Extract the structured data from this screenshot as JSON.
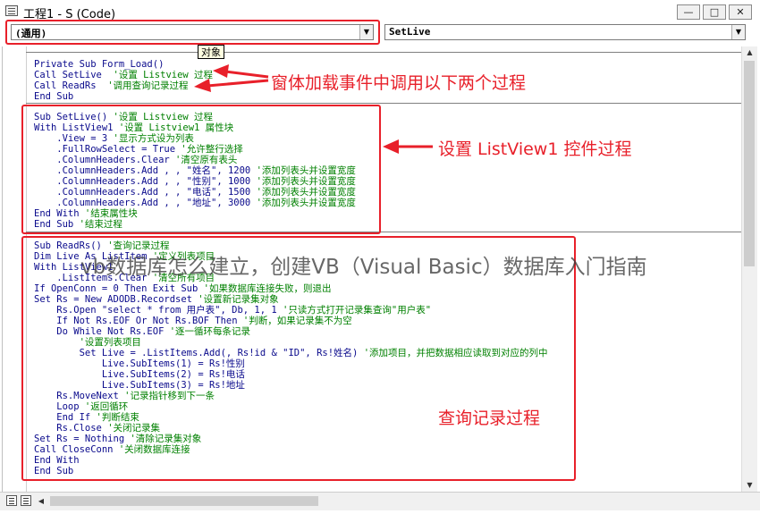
{
  "window": {
    "title": "工程1 - S (Code)"
  },
  "object_combo": {
    "value": "(通用)"
  },
  "proc_combo": {
    "value": "SetLive"
  },
  "tooltip": "对象",
  "code": {
    "form_load": [
      [
        [
          "kw",
          "Private Sub Form_Load()"
        ]
      ],
      [
        [
          "kw",
          "Call SetLive  "
        ],
        [
          "cm",
          "'设置 Listview 过程"
        ]
      ],
      [
        [
          "kw",
          "Call ReadRs  "
        ],
        [
          "cm",
          "'调用查询记录过程"
        ]
      ],
      [
        [
          "kw",
          "End Sub"
        ]
      ]
    ],
    "setlive": [
      [
        [
          "kw",
          "Sub SetLive() "
        ],
        [
          "cm",
          "'设置 Listview 过程"
        ]
      ],
      [
        [
          "kw",
          "With ListView1 "
        ],
        [
          "cm",
          "'设置 Listview1 属性块"
        ]
      ],
      [
        [
          "kw",
          "    .View = 3 "
        ],
        [
          "cm",
          "'显示方式设为列表"
        ]
      ],
      [
        [
          "kw",
          "    .FullRowSelect = True "
        ],
        [
          "cm",
          "'允许整行选择"
        ]
      ],
      [
        [
          "kw",
          "    .ColumnHeaders.Clear "
        ],
        [
          "cm",
          "'清空原有表头"
        ]
      ],
      [
        [
          "kw",
          "    .ColumnHeaders.Add , , \"姓名\", 1200 "
        ],
        [
          "cm",
          "'添加列表头并设置宽度"
        ]
      ],
      [
        [
          "kw",
          "    .ColumnHeaders.Add , , \"性别\", 1000 "
        ],
        [
          "cm",
          "'添加列表头并设置宽度"
        ]
      ],
      [
        [
          "kw",
          "    .ColumnHeaders.Add , , \"电话\", 1500 "
        ],
        [
          "cm",
          "'添加列表头并设置宽度"
        ]
      ],
      [
        [
          "kw",
          "    .ColumnHeaders.Add , , \"地址\", 3000 "
        ],
        [
          "cm",
          "'添加列表头并设置宽度"
        ]
      ],
      [
        [
          "kw",
          "End With "
        ],
        [
          "cm",
          "'结束属性块"
        ]
      ],
      [
        [
          "kw",
          "End Sub "
        ],
        [
          "cm",
          "'结束过程"
        ]
      ]
    ],
    "readrs": [
      [
        [
          "kw",
          "Sub ReadRs() "
        ],
        [
          "cm",
          "'查询记录过程"
        ]
      ],
      [
        [
          "kw",
          "Dim Live As ListItem "
        ],
        [
          "cm",
          "'定义列表项目"
        ]
      ],
      [
        [
          "kw",
          "With ListView1"
        ]
      ],
      [
        [
          "kw",
          "    .ListItems.Clear "
        ],
        [
          "cm",
          "'清空所有项目"
        ]
      ],
      [
        [
          "kw",
          "If OpenConn = 0 Then Exit Sub "
        ],
        [
          "cm",
          "'如果数据库连接失败，则退出"
        ]
      ],
      [
        [
          "kw",
          "Set Rs = New ADODB.Recordset "
        ],
        [
          "cm",
          "'设置新记录集对象"
        ]
      ],
      [
        [
          "kw",
          "    Rs.Open \"select * from 用户表\", Db, 1, 1 "
        ],
        [
          "cm",
          "'只读方式打开记录集查询\"用户表\""
        ]
      ],
      [
        [
          "kw",
          "    If Not Rs.EOF Or Not Rs.BOF Then "
        ],
        [
          "cm",
          "'判断，如果记录集不为空"
        ]
      ],
      [
        [
          "kw",
          "    Do While Not Rs.EOF "
        ],
        [
          "cm",
          "'逐一循环每条记录"
        ]
      ],
      [
        [
          "kw",
          "        "
        ],
        [
          "cm",
          "'设置列表项目"
        ]
      ],
      [
        [
          "kw",
          "        Set Live = .ListItems.Add(, Rs!id & \"ID\", Rs!姓名) "
        ],
        [
          "cm",
          "'添加项目，并把数据相应读取到对应的列中"
        ]
      ],
      [
        [
          "kw",
          "            Live.SubItems(1) = Rs!性别"
        ]
      ],
      [
        [
          "kw",
          "            Live.SubItems(2) = Rs!电话"
        ]
      ],
      [
        [
          "kw",
          "            Live.SubItems(3) = Rs!地址"
        ]
      ],
      [
        [
          "kw",
          "    Rs.MoveNext "
        ],
        [
          "cm",
          "'记录指针移到下一条"
        ]
      ],
      [
        [
          "kw",
          "    Loop "
        ],
        [
          "cm",
          "'返回循环"
        ]
      ],
      [
        [
          "kw",
          "    End If "
        ],
        [
          "cm",
          "'判断结束"
        ]
      ],
      [
        [
          "kw",
          "    Rs.Close "
        ],
        [
          "cm",
          "'关闭记录集"
        ]
      ],
      [
        [
          "kw",
          "Set Rs = Nothing "
        ],
        [
          "cm",
          "'清除记录集对象"
        ]
      ],
      [
        [
          "kw",
          "Call CloseConn "
        ],
        [
          "cm",
          "'关闭数据库连接"
        ]
      ],
      [
        [
          "kw",
          "End With"
        ]
      ],
      [
        [
          "kw",
          "End Sub"
        ]
      ]
    ]
  },
  "annotations": {
    "form_load": "窗体加载事件中调用以下两个过程",
    "setlive": "设置 ListView1 控件过程",
    "readrs": "查询记录过程"
  },
  "watermark": "vb数据库怎么建立，创建VB（Visual Basic）数据库入门指南",
  "colors": {
    "annotation": "#e8202a",
    "keyword": "#0a0a8c",
    "comment": "#008000"
  },
  "icons": [
    "app-icon",
    "minimize-icon",
    "maximize-icon",
    "close-icon",
    "chevron-down-icon",
    "arrow-left-icon",
    "procedure-view-icon",
    "full-module-view-icon"
  ]
}
